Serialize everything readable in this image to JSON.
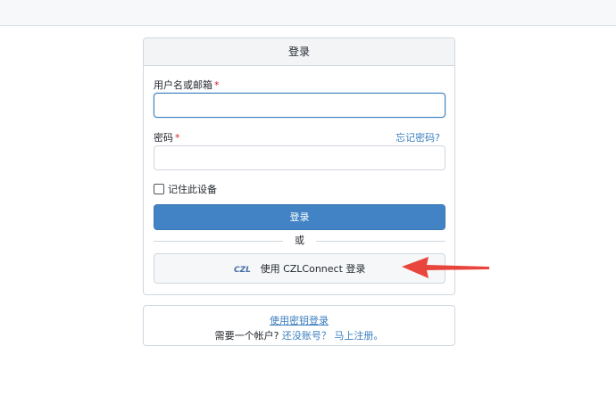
{
  "login_card": {
    "title": "登录",
    "username_label": "用户名或邮箱",
    "required_mark": "*",
    "username_value": "",
    "password_label": "密码",
    "password_value": "",
    "forgot_link": "忘记密码?",
    "remember_label": "记住此设备",
    "submit_label": "登录",
    "or_text": "或",
    "oauth_label": "使用 CZLConnect 登录",
    "oauth_logo_text": "CZL"
  },
  "secondary_card": {
    "passkey_link": "使用密钥登录",
    "need_account_text": "需要一个帐户?",
    "register_link": "还没账号？ 马上注册。"
  },
  "colors": {
    "accent": "#4183c4",
    "link": "#3a7ebf",
    "annotation_arrow": "#e8453c"
  }
}
